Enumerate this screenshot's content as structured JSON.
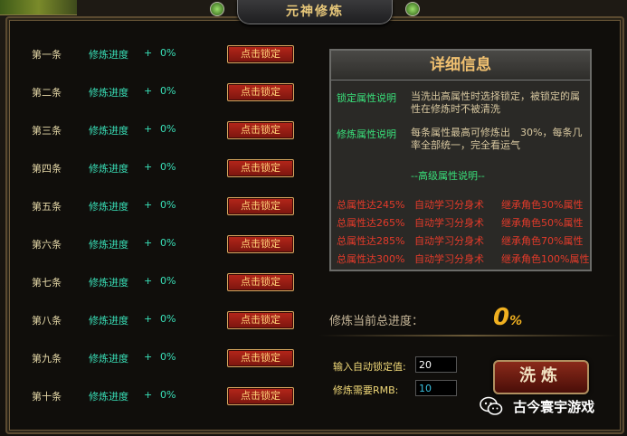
{
  "window": {
    "title": "元神修炼",
    "corner_text": ""
  },
  "rows": [
    {
      "index": "第一条",
      "label": "修炼进度",
      "plus": "+",
      "percent": "0%",
      "button": "点击锁定"
    },
    {
      "index": "第二条",
      "label": "修炼进度",
      "plus": "+",
      "percent": "0%",
      "button": "点击锁定"
    },
    {
      "index": "第三条",
      "label": "修炼进度",
      "plus": "+",
      "percent": "0%",
      "button": "点击锁定"
    },
    {
      "index": "第四条",
      "label": "修炼进度",
      "plus": "+",
      "percent": "0%",
      "button": "点击锁定"
    },
    {
      "index": "第五条",
      "label": "修炼进度",
      "plus": "+",
      "percent": "0%",
      "button": "点击锁定"
    },
    {
      "index": "第六条",
      "label": "修炼进度",
      "plus": "+",
      "percent": "0%",
      "button": "点击锁定"
    },
    {
      "index": "第七条",
      "label": "修炼进度",
      "plus": "+",
      "percent": "0%",
      "button": "点击锁定"
    },
    {
      "index": "第八条",
      "label": "修炼进度",
      "plus": "+",
      "percent": "0%",
      "button": "点击锁定"
    },
    {
      "index": "第九条",
      "label": "修炼进度",
      "plus": "+",
      "percent": "0%",
      "button": "点击锁定"
    },
    {
      "index": "第十条",
      "label": "修炼进度",
      "plus": "+",
      "percent": "0%",
      "button": "点击锁定"
    }
  ],
  "info": {
    "title": "详细信息",
    "lock_label": "锁定属性说明",
    "lock_text": "当洗出高属性时选择锁定，被锁定的属性在修炼时不被清洗",
    "train_label": "修炼属性说明",
    "train_text": "每条属性最高可修炼出　30%，每条几率全部统一，完全看运气",
    "advanced": "--高级属性说明--",
    "attrs": [
      {
        "a": "总属性达245%",
        "b": "自动学习分身术",
        "c": "继承角色30%属性"
      },
      {
        "a": "总属性达265%",
        "b": "自动学习分身术",
        "c": "继承角色50%属性"
      },
      {
        "a": "总属性达285%",
        "b": "自动学习分身术",
        "c": "继承角色70%属性"
      },
      {
        "a": "总属性达300%",
        "b": "自动学习分身术",
        "c": "继承角色100%属性"
      }
    ]
  },
  "progress": {
    "label": "修炼当前总进度：",
    "value": "0",
    "unit": "%"
  },
  "form": {
    "auto_lock_label": "输入自动锁定值:",
    "auto_lock_value": "20",
    "rmb_label": "修炼需要RMB:",
    "rmb_value": "10"
  },
  "wash_button": "洗炼",
  "watermark": {
    "text": "古今寰宇游戏",
    "icon": "wechat-icon"
  },
  "colors": {
    "accent_green": "#39e0b8",
    "attr_red": "#e53a2a",
    "button_red": "#9a1e14",
    "title_gold": "#f0c070"
  }
}
